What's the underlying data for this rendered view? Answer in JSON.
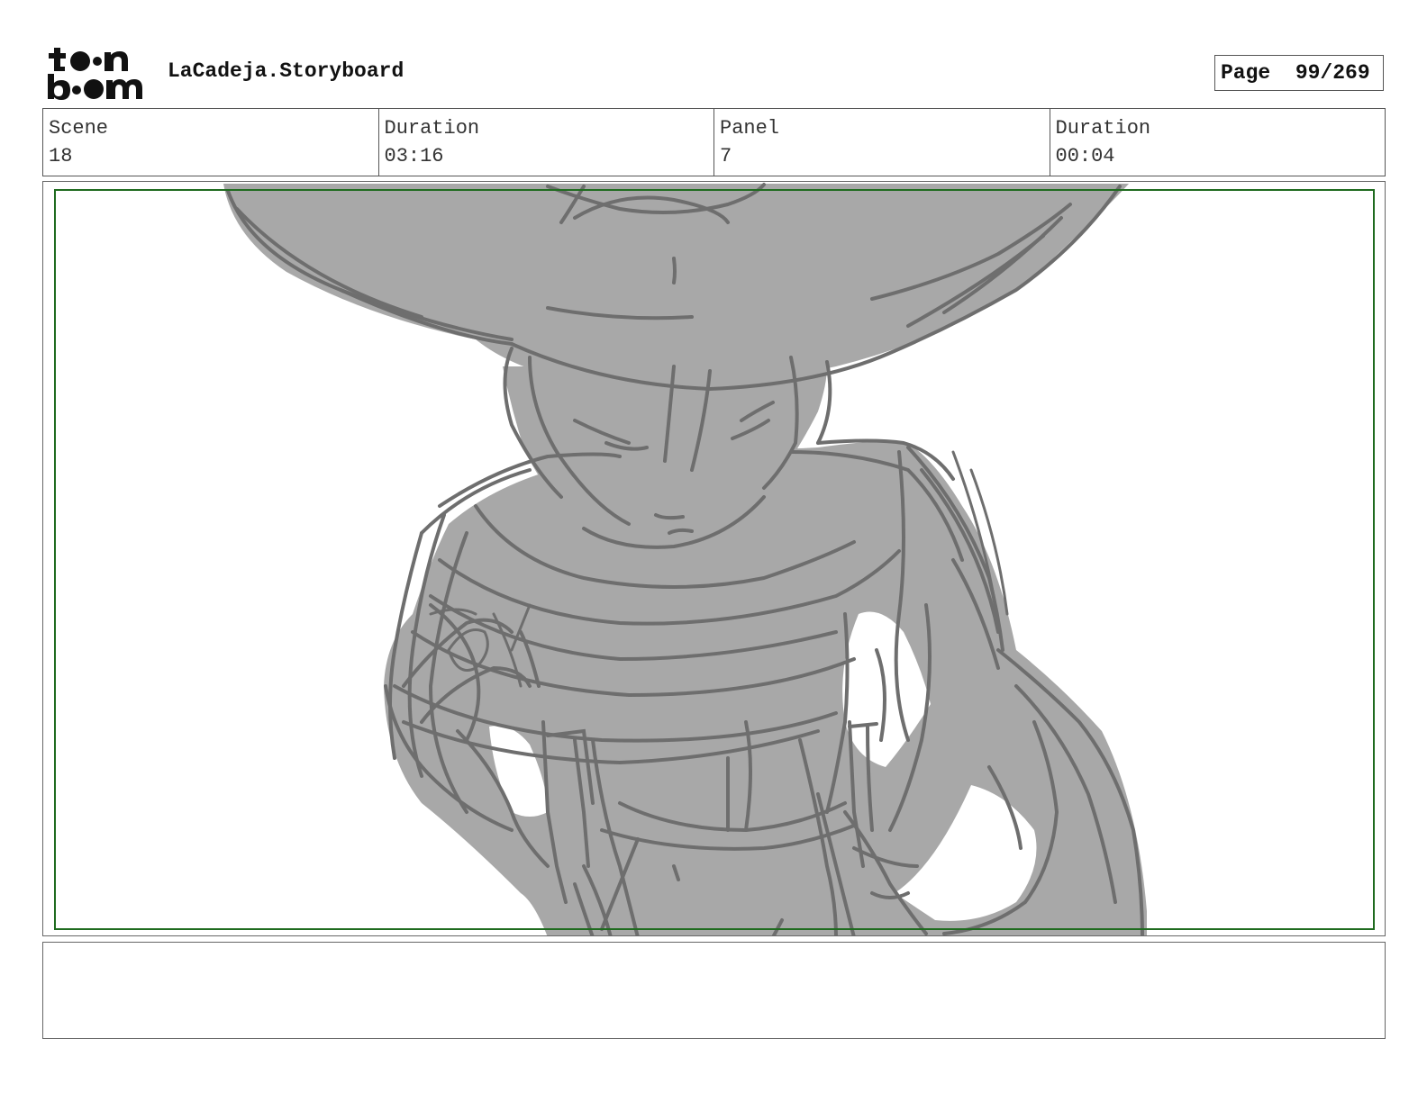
{
  "header": {
    "logo": {
      "name": "toon-boom-logo",
      "text": "toon boom"
    },
    "title": "LaCadeja.Storyboard",
    "page": "Page  99/269"
  },
  "info": {
    "scene_label": "Scene",
    "scene_value": "18",
    "scene_duration_label": "Duration",
    "scene_duration_value": "03:16",
    "panel_label": "Panel",
    "panel_value": "7",
    "panel_duration_label": "Duration",
    "panel_duration_value": "00:04"
  },
  "panel": {
    "sketch": "character-sketch",
    "colors": {
      "fill": "#a8a8a8",
      "stroke": "#6e6e6e",
      "safe_frame": "#1f6b1f"
    }
  },
  "notes": {
    "text": ""
  }
}
